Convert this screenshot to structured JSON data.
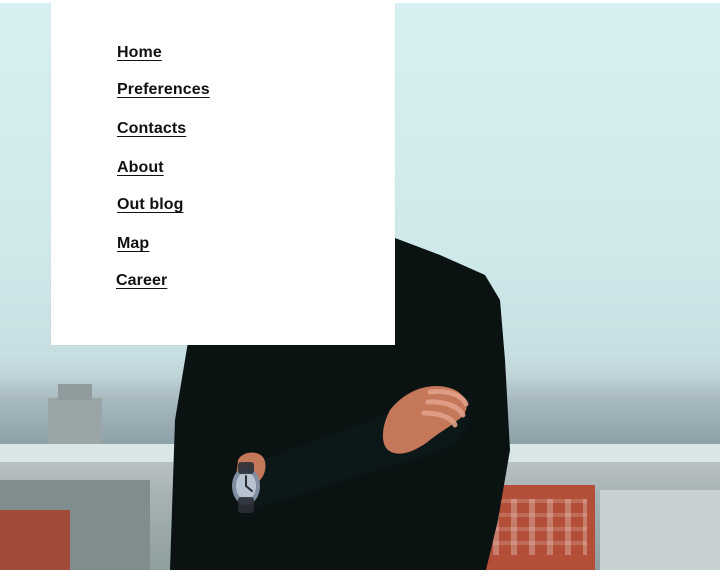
{
  "menu": {
    "items": [
      {
        "label": "Home"
      },
      {
        "label": "Preferences"
      },
      {
        "label": "Contacts"
      },
      {
        "label": "About"
      },
      {
        "label": "Out blog"
      },
      {
        "label": "Map"
      },
      {
        "label": "Career"
      }
    ]
  },
  "hero": {
    "image_description_icons": [
      "person-in-black-sweater",
      "wristwatch-icon",
      "city-skyline"
    ]
  },
  "colors": {
    "menu_background": "#ffffff",
    "menu_text": "#111111",
    "sky": "#d7f0f1",
    "sweater": "#0a1212",
    "skin": "#c5775a",
    "brick": "#b34f38"
  }
}
